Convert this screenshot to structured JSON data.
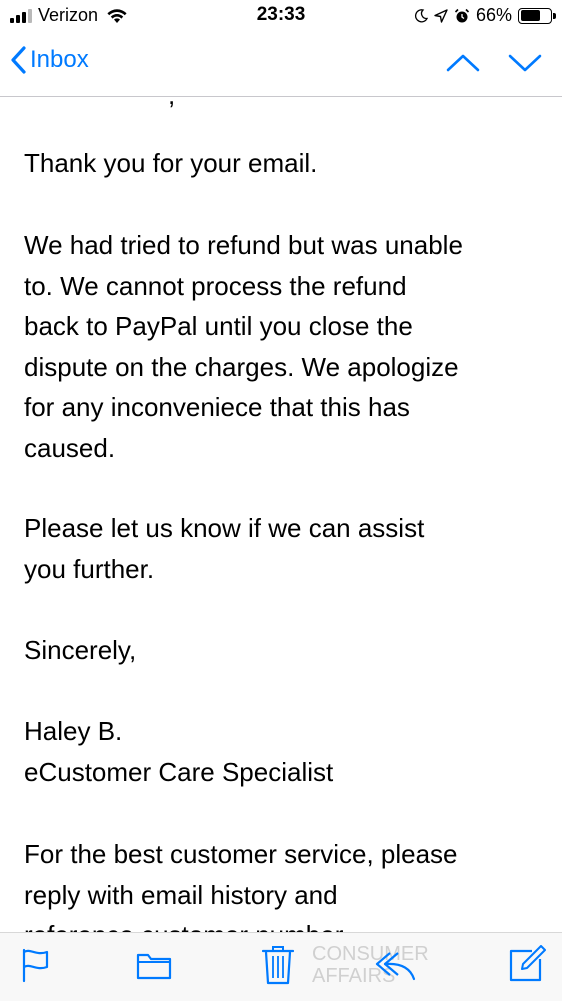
{
  "status_bar": {
    "carrier": "Verizon",
    "time": "23:33",
    "battery_percent": "66%",
    "battery_level": 0.66,
    "icons": [
      "signal-icon",
      "wifi-icon",
      "moon-icon",
      "location-icon",
      "alarm-icon",
      "battery-icon"
    ]
  },
  "nav": {
    "back_label": "Inbox",
    "icons": [
      "chevron-left-icon",
      "chevron-up-icon",
      "chevron-down-icon"
    ],
    "accent_color": "#007aff"
  },
  "email": {
    "cut_line": ",",
    "greeting": "Thank you for your email.",
    "paragraph1": [
      "We had tried to refund but was unable",
      "to. We cannot process the refund",
      "back to PayPal until you close the",
      "dispute on the charges. We apologize",
      "for any inconveniece that this has",
      "caused."
    ],
    "paragraph2": [
      "Please let us know if we can assist",
      "you further."
    ],
    "closing": "Sincerely,",
    "signature_name": "Haley B.",
    "signature_title": "eCustomer Care Specialist",
    "paragraph3": [
      "For the best customer service, please",
      "reply with email history and",
      "reference customer number"
    ]
  },
  "toolbar": {
    "icons": [
      "flag-icon",
      "folder-icon",
      "trash-icon",
      "reply-icon",
      "compose-icon"
    ],
    "watermark": "CONSUMER\nAFFAIRS"
  }
}
